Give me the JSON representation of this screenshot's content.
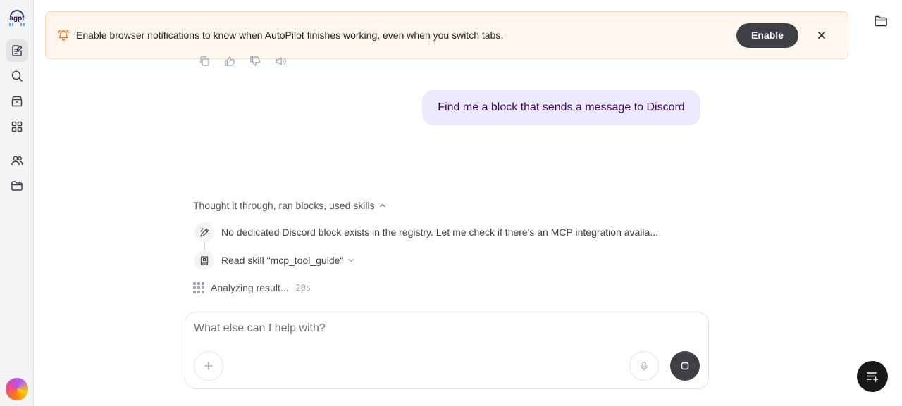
{
  "sidebar": {
    "logo_label": "agpt",
    "items": [
      {
        "name": "chat",
        "icon": "chat-list-icon",
        "active": true
      },
      {
        "name": "search",
        "icon": "search-icon"
      },
      {
        "name": "marketplace",
        "icon": "store-icon"
      },
      {
        "name": "blocks",
        "icon": "grid-icon"
      },
      {
        "name": "agents",
        "icon": "users-icon"
      },
      {
        "name": "library",
        "icon": "folder-icon"
      }
    ]
  },
  "banner": {
    "message": "Enable browser notifications to know when AutoPilot finishes working, even when you switch tabs.",
    "enable_label": "Enable"
  },
  "chat": {
    "user_message": "Find me a block that sends a message to Discord",
    "thought_summary": "Thought it through, ran blocks, used skills",
    "steps": [
      {
        "icon": "edit-icon",
        "text": "No dedicated Discord block exists in the registry. Let me check if there's an MCP integration availa..."
      },
      {
        "icon": "book-icon",
        "text": "Read skill \"mcp_tool_guide\""
      }
    ],
    "status_text": "Analyzing result...",
    "status_timer": "20s"
  },
  "composer": {
    "placeholder": "What else can I help with?",
    "value": ""
  },
  "colors": {
    "accent_dark": "#3f3f46",
    "user_bubble": "#ede9fe",
    "banner_bg": "#fff7ed",
    "bell": "#f97316"
  }
}
